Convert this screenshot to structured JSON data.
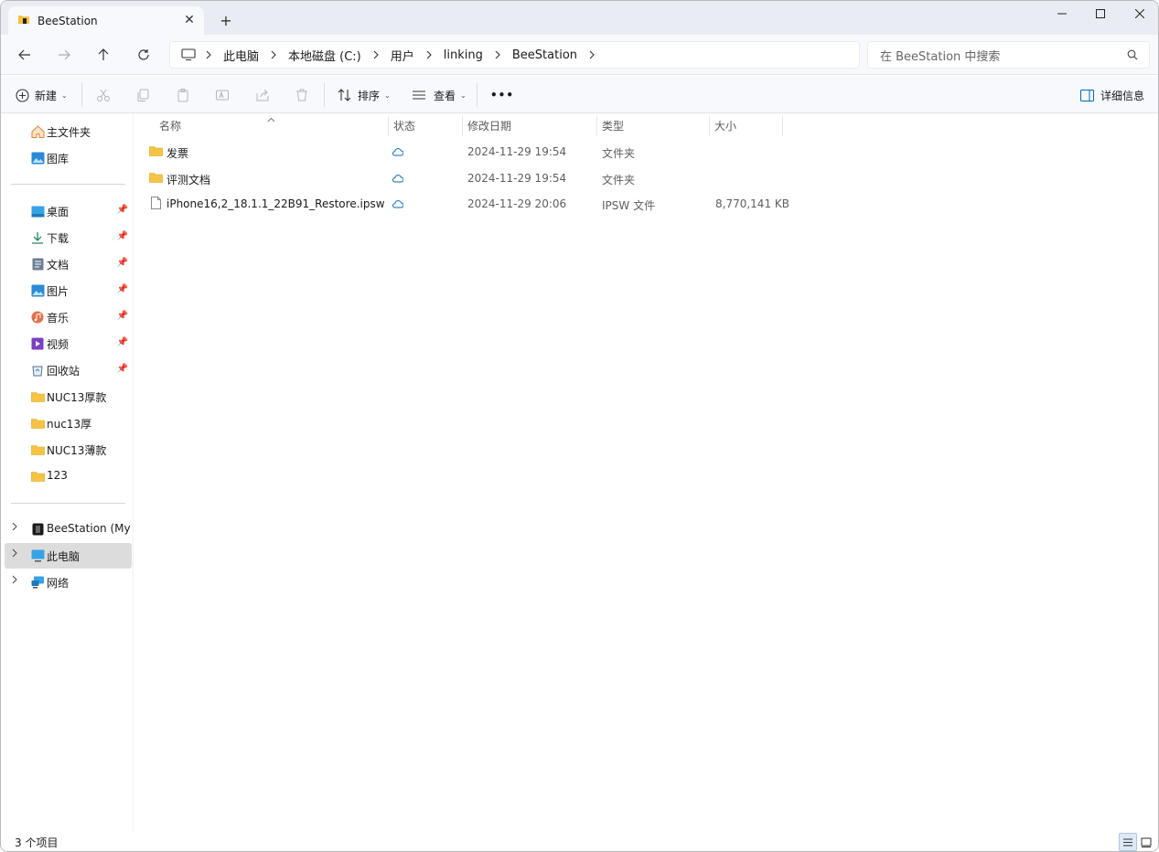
{
  "window": {
    "tab_title": "BeeStation",
    "new_tab": "+",
    "close_tab": "✕"
  },
  "address": {
    "breadcrumbs": [
      "此电脑",
      "本地磁盘 (C:)",
      "用户",
      "linking",
      "BeeStation"
    ]
  },
  "search": {
    "placeholder": "在 BeeStation 中搜索"
  },
  "toolbar": {
    "new_label": "新建",
    "sort_label": "排序",
    "view_label": "查看",
    "more_label": "•••",
    "details_label": "详细信息"
  },
  "sidebar": {
    "top": [
      {
        "label": "主文件夹",
        "icon": "home-icon"
      },
      {
        "label": "图库",
        "icon": "gallery-icon"
      }
    ],
    "quick": [
      {
        "label": "桌面",
        "icon": "desktop-icon"
      },
      {
        "label": "下载",
        "icon": "download-icon"
      },
      {
        "label": "文档",
        "icon": "document-icon"
      },
      {
        "label": "图片",
        "icon": "pictures-icon"
      },
      {
        "label": "音乐",
        "icon": "music-icon"
      },
      {
        "label": "视频",
        "icon": "video-icon"
      },
      {
        "label": "回收站",
        "icon": "recycle-bin-icon"
      },
      {
        "label": "NUC13厚款",
        "icon": "folder-icon"
      },
      {
        "label": "nuc13厚",
        "icon": "folder-icon"
      },
      {
        "label": "NUC13薄款",
        "icon": "folder-icon"
      },
      {
        "label": "123",
        "icon": "folder-icon"
      }
    ],
    "locations": [
      {
        "label": "BeeStation (MyBee",
        "icon": "drive-icon"
      },
      {
        "label": "此电脑",
        "icon": "computer-icon",
        "selected": true
      },
      {
        "label": "网络",
        "icon": "network-icon"
      }
    ]
  },
  "columns": {
    "name": "名称",
    "status": "状态",
    "modified": "修改日期",
    "type": "类型",
    "size": "大小"
  },
  "files": [
    {
      "name": "发票",
      "modified": "2024-11-29 19:54",
      "type": "文件夹",
      "size": "",
      "icon": "folder-icon",
      "status": "cloud-icon"
    },
    {
      "name": "评测文档",
      "modified": "2024-11-29 19:54",
      "type": "文件夹",
      "size": "",
      "icon": "folder-icon",
      "status": "cloud-icon"
    },
    {
      "name": "iPhone16,2_18.1.1_22B91_Restore.ipsw",
      "modified": "2024-11-29 20:06",
      "type": "IPSW 文件",
      "size": "8,770,141 KB",
      "icon": "file-icon",
      "status": "cloud-icon"
    }
  ],
  "statusbar": {
    "count": "3 个项目"
  },
  "colors": {
    "accent": "#0067c0",
    "folder": "#f6c343",
    "chrome": "#e9edf3"
  }
}
